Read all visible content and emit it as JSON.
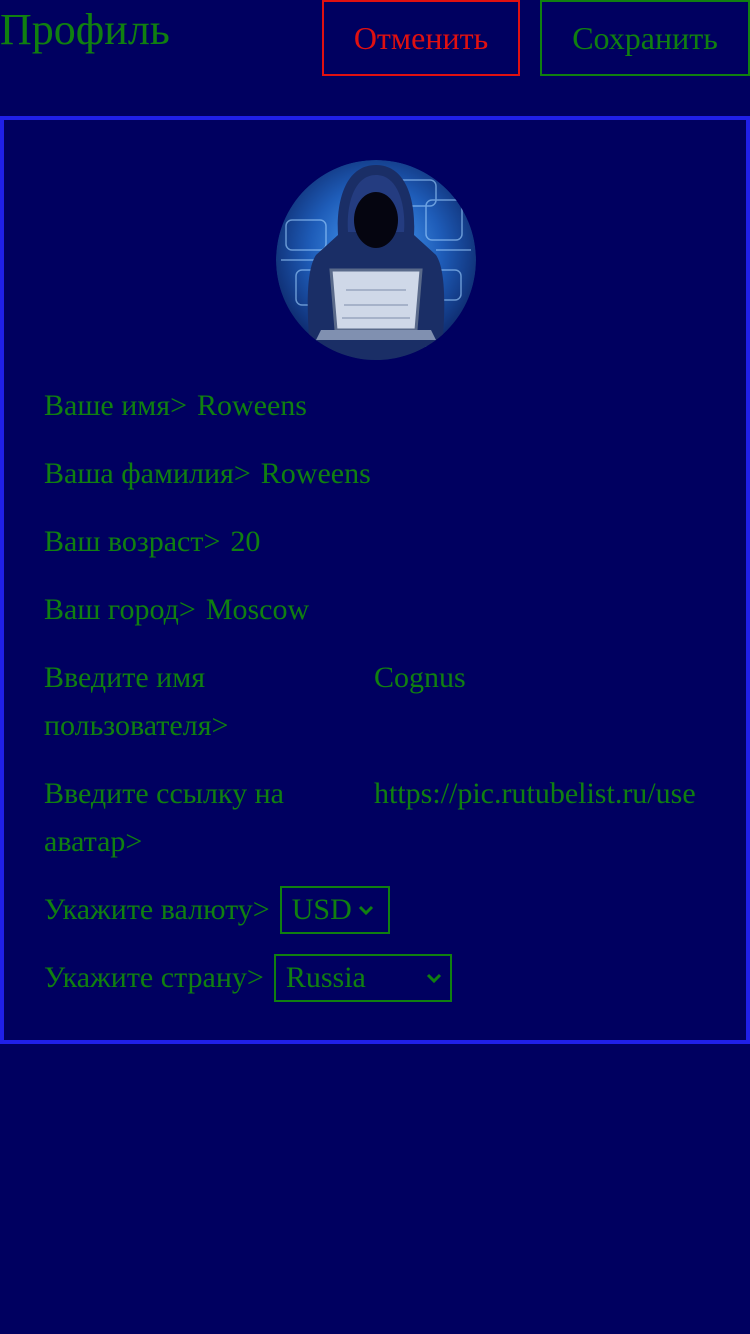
{
  "header": {
    "title": "Профиль",
    "cancel_label": "Отменить",
    "save_label": "Сохранить"
  },
  "profile": {
    "first_name": {
      "label": "Ваше имя>",
      "value": "Roweens"
    },
    "last_name": {
      "label": "Ваша фамилия>",
      "value": "Roweens"
    },
    "age": {
      "label": "Ваш возраст>",
      "value": "20"
    },
    "city": {
      "label": "Ваш город>",
      "value": "Moscow"
    },
    "username": {
      "label": "Введите имя пользователя>",
      "value": "Cognus"
    },
    "avatar_url": {
      "label": "Введите ссылку на аватар>",
      "value": "https://pic.rutubelist.ru/use"
    },
    "currency": {
      "label": "Укажите валюту>",
      "selected": "USD"
    },
    "country": {
      "label": "Укажите страну>",
      "selected": "Russia"
    }
  },
  "colors": {
    "background": "#000060",
    "text": "#108010",
    "cancel": "#e01010",
    "card_border": "#2020e8"
  },
  "icons": {
    "avatar": "hooded-hacker-avatar",
    "dropdown": "chevron-down-icon"
  }
}
